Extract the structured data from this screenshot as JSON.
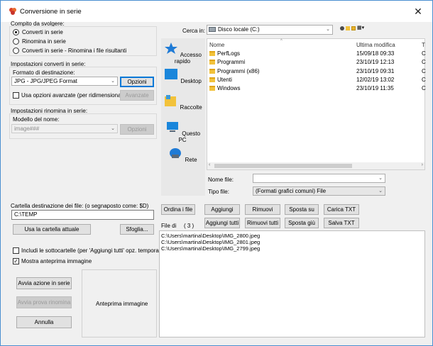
{
  "window": {
    "title": "Conversione in serie"
  },
  "task": {
    "group_label": "Compito da svolgere:",
    "options": [
      "Converti in serie",
      "Rinomina in serie",
      "Converti in serie - Rinomina i file risultanti"
    ],
    "selected_index": 0
  },
  "convert_settings": {
    "group_label": "Impostazioni converti in serie:",
    "format_label": "Formato di destinazione:",
    "format_value": "JPG - JPG/JPEG Format",
    "options_button": "Opzioni",
    "advanced_checkbox": "Usa opzioni avanzate (per ridimensiona...)",
    "advanced_checked": false,
    "advanced_button": "Avanzate"
  },
  "rename_settings": {
    "group_label": "Impostazioni rinomina in serie:",
    "pattern_label": "Modello del nome:",
    "pattern_value": "image###",
    "options_button": "Opzioni"
  },
  "destination": {
    "label": "Cartella destinazione dei file: (o segnaposto come: $D)",
    "value": "C:\\TEMP",
    "use_current_button": "Usa la cartella attuale",
    "browse_button": "Sfoglia..."
  },
  "include_subfolders": {
    "label": "Includi le sottocartelle (per 'Aggiungi tutti' opz. temporanea)",
    "checked": false
  },
  "show_preview": {
    "label": "Mostra anteprima immagine",
    "checked": true
  },
  "actions": {
    "start": "Avvia azione in serie",
    "test_rename": "Avvia prova rinomina",
    "cancel": "Annulla"
  },
  "preview": {
    "label": "Anteprima immagine"
  },
  "browser": {
    "look_in_label": "Cerca in:",
    "look_in_value": "Disco locale (C:)",
    "columns": [
      "Nome",
      "Ultima modifica",
      "T"
    ],
    "nav": [
      "Accesso rapido",
      "Desktop",
      "Raccolte",
      "Questo PC",
      "Rete"
    ],
    "rows": [
      {
        "name": "PerfLogs",
        "date": "15/09/18 09:33",
        "type": "C"
      },
      {
        "name": "Programmi",
        "date": "23/10/19 12:13",
        "type": "C"
      },
      {
        "name": "Programmi (x86)",
        "date": "23/10/19 09:31",
        "type": "C"
      },
      {
        "name": "Utenti",
        "date": "12/02/19 13:02",
        "type": "C"
      },
      {
        "name": "Windows",
        "date": "23/10/19 11:35",
        "type": "C"
      }
    ],
    "filename_label": "Nome file:",
    "filename_value": "",
    "filetype_label": "Tipo file:",
    "filetype_value": "(Formati grafici comuni) File"
  },
  "list_buttons": {
    "sort": "Ordina i file",
    "add": "Aggiungi",
    "remove": "Rimuovi",
    "move_up": "Sposta su",
    "load_txt": "Carica TXT",
    "add_all": "Aggiungi tutti",
    "remove_all": "Rimuovi tutti",
    "move_down": "Sposta giù",
    "save_txt": "Salva TXT"
  },
  "files": {
    "label": "File di",
    "count": "( 3 )",
    "items": [
      "C:\\Users\\martina\\Desktop\\IMG_2800.jpeg",
      "C:\\Users\\martina\\Desktop\\IMG_2801.jpeg",
      "C:\\Users\\martina\\Desktop\\IMG_2799.jpeg"
    ]
  }
}
